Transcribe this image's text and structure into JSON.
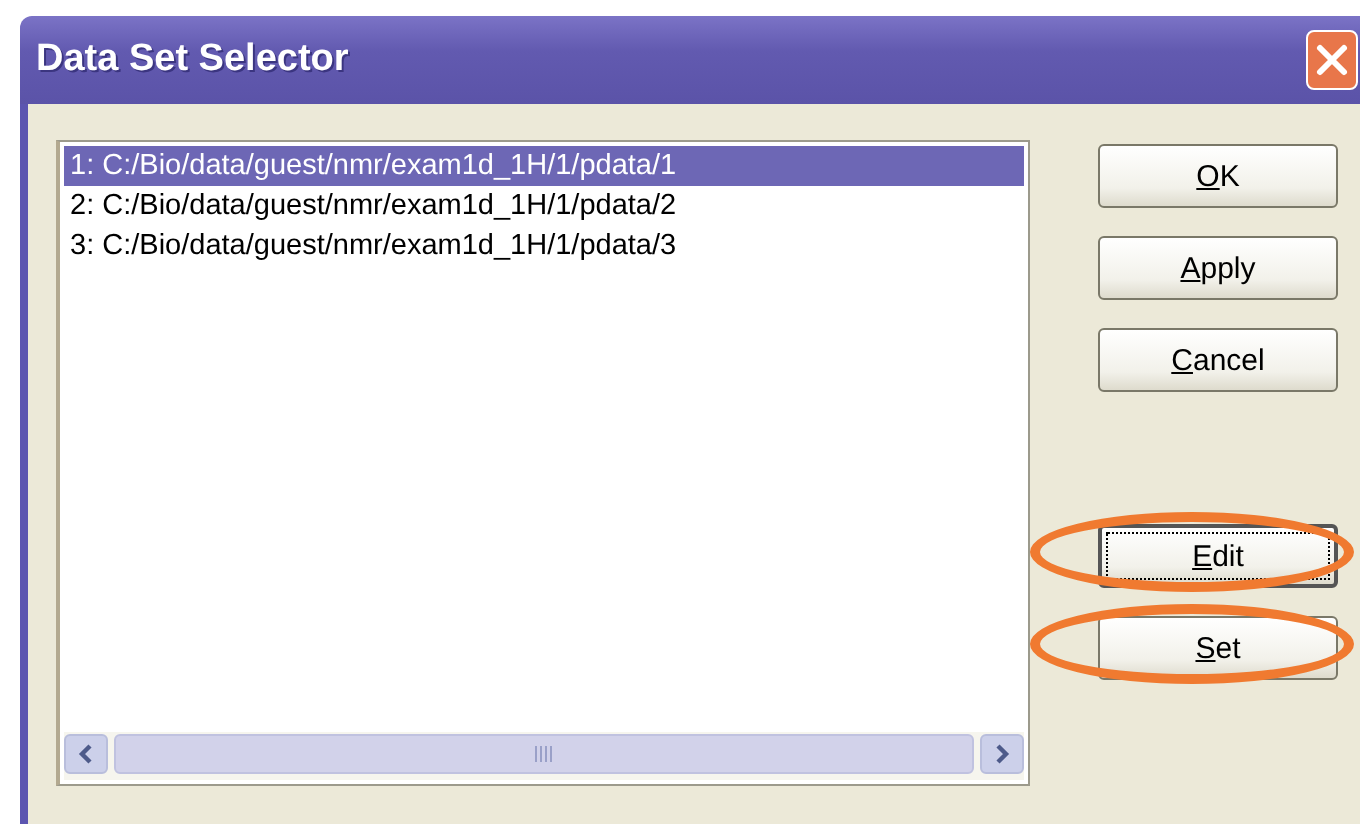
{
  "window": {
    "title": "Data Set Selector"
  },
  "list": {
    "items": [
      {
        "label": "1: C:/Bio/data/guest/nmr/exam1d_1H/1/pdata/1",
        "selected": true
      },
      {
        "label": "2: C:/Bio/data/guest/nmr/exam1d_1H/1/pdata/2",
        "selected": false
      },
      {
        "label": "3: C:/Bio/data/guest/nmr/exam1d_1H/1/pdata/3",
        "selected": false
      }
    ]
  },
  "button_groups": [
    {
      "buttons": [
        {
          "label": "OK",
          "underline_first": true,
          "focused": false,
          "highlighted": false
        },
        {
          "label": "Apply",
          "underline_first": true,
          "focused": false,
          "highlighted": false
        },
        {
          "label": "Cancel",
          "underline_first": true,
          "focused": false,
          "highlighted": false
        }
      ]
    },
    {
      "buttons": [
        {
          "label": "Edit",
          "underline_first": true,
          "focused": true,
          "highlighted": true
        },
        {
          "label": "Set",
          "underline_first": true,
          "focused": false,
          "highlighted": true
        }
      ]
    }
  ]
}
